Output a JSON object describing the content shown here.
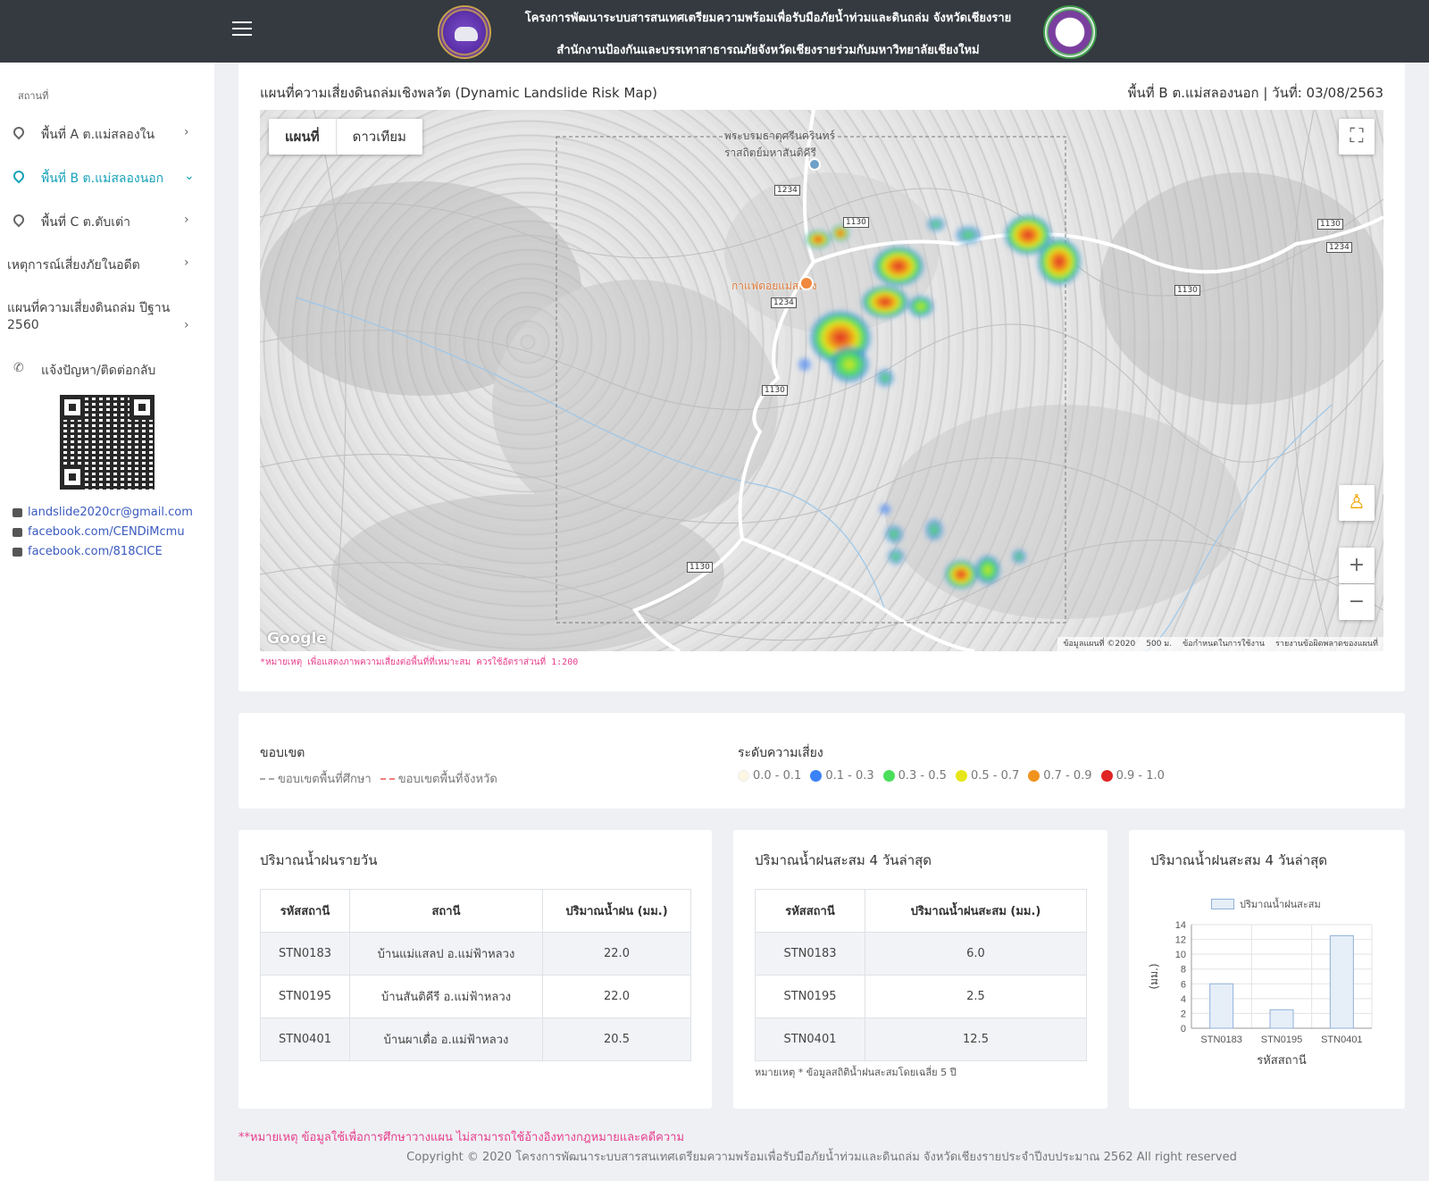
{
  "header": {
    "title_line1": "โครงการพัฒนาระบบสารสนเทศเตรียมความพร้อมเพื่อรับมือภัยน้ำท่วมและดินถล่ม จังหวัดเชียงราย",
    "title_line2": "สำนักงานป้องกันและบรรเทาสาธารณภัยจังหวัดเชียงรายร่วมกับมหาวิทยาลัยเชียงใหม่"
  },
  "sidebar": {
    "section_label": "สถานที่",
    "items": [
      {
        "label": "พื้นที่ A ต.แม่สลองใน",
        "icon": "map-pin-icon",
        "chevron": "›"
      },
      {
        "label": "พื้นที่ B ต.แม่สลองนอก",
        "icon": "map-pin-icon",
        "chevron": "⌄"
      },
      {
        "label": "พื้นที่ C ต.ตับเต่า",
        "icon": "map-pin-icon",
        "chevron": "›"
      },
      {
        "label": "เหตุการณ์เสี่ยงภัยในอดีต",
        "chevron": "›"
      },
      {
        "label_line1": "แผนที่ความเสี่ยงดินถล่ม ปีฐาน",
        "label_line2": "2560",
        "chevron": "›"
      },
      {
        "label": "แจ้งปัญหา/ติดต่อกลับ",
        "icon": "phone-icon"
      }
    ],
    "contacts": [
      {
        "text": "landslide2020cr@gmail.com",
        "icon": "mail-icon"
      },
      {
        "text": "facebook.com/CENDiMcmu",
        "icon": "facebook-icon"
      },
      {
        "text": "facebook.com/818CICE",
        "icon": "facebook-icon"
      }
    ]
  },
  "map_card": {
    "title": "แผนที่ความเสี่ยงดินถล่มเชิงพลวัต (Dynamic Landslide Risk Map)",
    "info": "พื้นที่ B ต.แม่สลองนอก | วันที่: 03/08/2563",
    "map_type_map": "แผนที่",
    "map_type_satellite": "ดาวเทียม",
    "google": "Google",
    "places": [
      "พระบรมธาตุศรีนครินทร์",
      "ราสถิตย์มหาสันติคีรี",
      "กาแฟดอยแม่สลอง"
    ],
    "road_labels": [
      "1234",
      "1130",
      "1234",
      "1130",
      "1130",
      "1130",
      "1234",
      "1130"
    ],
    "footer_items": [
      "ข้อมูลแผนที่ ©2020",
      "500 ม.",
      "ข้อกำหนดในการใช้งาน",
      "รายงานข้อผิดพลาดของแผนที่"
    ],
    "note": "*หมายเหตุ เพื่อแสดงภาพความเสี่ยงต่อพื้นที่ที่เหมาะสม ควรใช้อัตราส่วนที่ 1:200"
  },
  "legend": {
    "boundary_title": "ขอบเขต",
    "boundary_items": [
      "ขอบเขตพื้นที่ศึกษา",
      "ขอบเขตพื้นที่จังหวัด"
    ],
    "risk_title": "ระดับความเสี่ยง",
    "risk_items": [
      {
        "label": "0.0 - 0.1",
        "color": "#fdf6e3"
      },
      {
        "label": "0.1 - 0.3",
        "color": "#3b82f6"
      },
      {
        "label": "0.3 - 0.5",
        "color": "#4ade5c"
      },
      {
        "label": "0.5 - 0.7",
        "color": "#e6e619"
      },
      {
        "label": "0.7 - 0.9",
        "color": "#f0931e"
      },
      {
        "label": "0.9 - 1.0",
        "color": "#e02424"
      }
    ]
  },
  "daily_rain": {
    "title": "ปริมาณน้ำฝนรายวัน",
    "headers": [
      "รหัสสถานี",
      "สถานี",
      "ปริมาณน้ำฝน (มม.)"
    ],
    "rows": [
      [
        "STN0183",
        "บ้านแม่แสลป อ.แม่ฟ้าหลวง",
        "22.0"
      ],
      [
        "STN0195",
        "บ้านสันติคีรี อ.แม่ฟ้าหลวง",
        "22.0"
      ],
      [
        "STN0401",
        "บ้านผาเดื่อ อ.แม่ฟ้าหลวง",
        "20.5"
      ]
    ]
  },
  "accum_rain": {
    "title": "ปริมาณน้ำฝนสะสม 4 วันล่าสุด",
    "headers": [
      "รหัสสถานี",
      "ปริมาณน้ำฝนสะสม (มม.)"
    ],
    "rows": [
      [
        "STN0183",
        "6.0"
      ],
      [
        "STN0195",
        "2.5"
      ],
      [
        "STN0401",
        "12.5"
      ]
    ],
    "note": "หมายเหตุ * ข้อมูลสถิติน้ำฝนสะสมโดยเฉลี่ย 5 ปี"
  },
  "chart_card": {
    "title": "ปริมาณน้ำฝนสะสม 4 วันล่าสุด"
  },
  "chart_data": {
    "type": "bar",
    "categories": [
      "STN0183",
      "STN0195",
      "STN0401"
    ],
    "series": [
      {
        "name": "ปริมาณน้ำฝนสะสม",
        "values": [
          6.0,
          2.5,
          12.5
        ]
      }
    ],
    "xlabel": "รหัสสถานี",
    "ylabel": "(มม.)",
    "ylim": [
      0,
      14
    ],
    "yticks": [
      0,
      2,
      4,
      6,
      8,
      10,
      12,
      14
    ],
    "grid": true,
    "legend": "top",
    "bar_fill": "#e6eef8",
    "bar_stroke": "#8fb2d8"
  },
  "footer": {
    "note": "**หมายเหตุ ข้อมูลใช้เพื่อการศึกษาวางแผน ไม่สามารถใช้อ้างอิงทางกฎหมายและคดีความ",
    "copyright": "Copyright © 2020 โครงการพัฒนาระบบสารสนเทศเตรียมความพร้อมเพื่อรับมือภัยน้ำท่วมและดินถล่ม จังหวัดเชียงรายประจำปีงบประมาณ 2562 All right reserved"
  }
}
